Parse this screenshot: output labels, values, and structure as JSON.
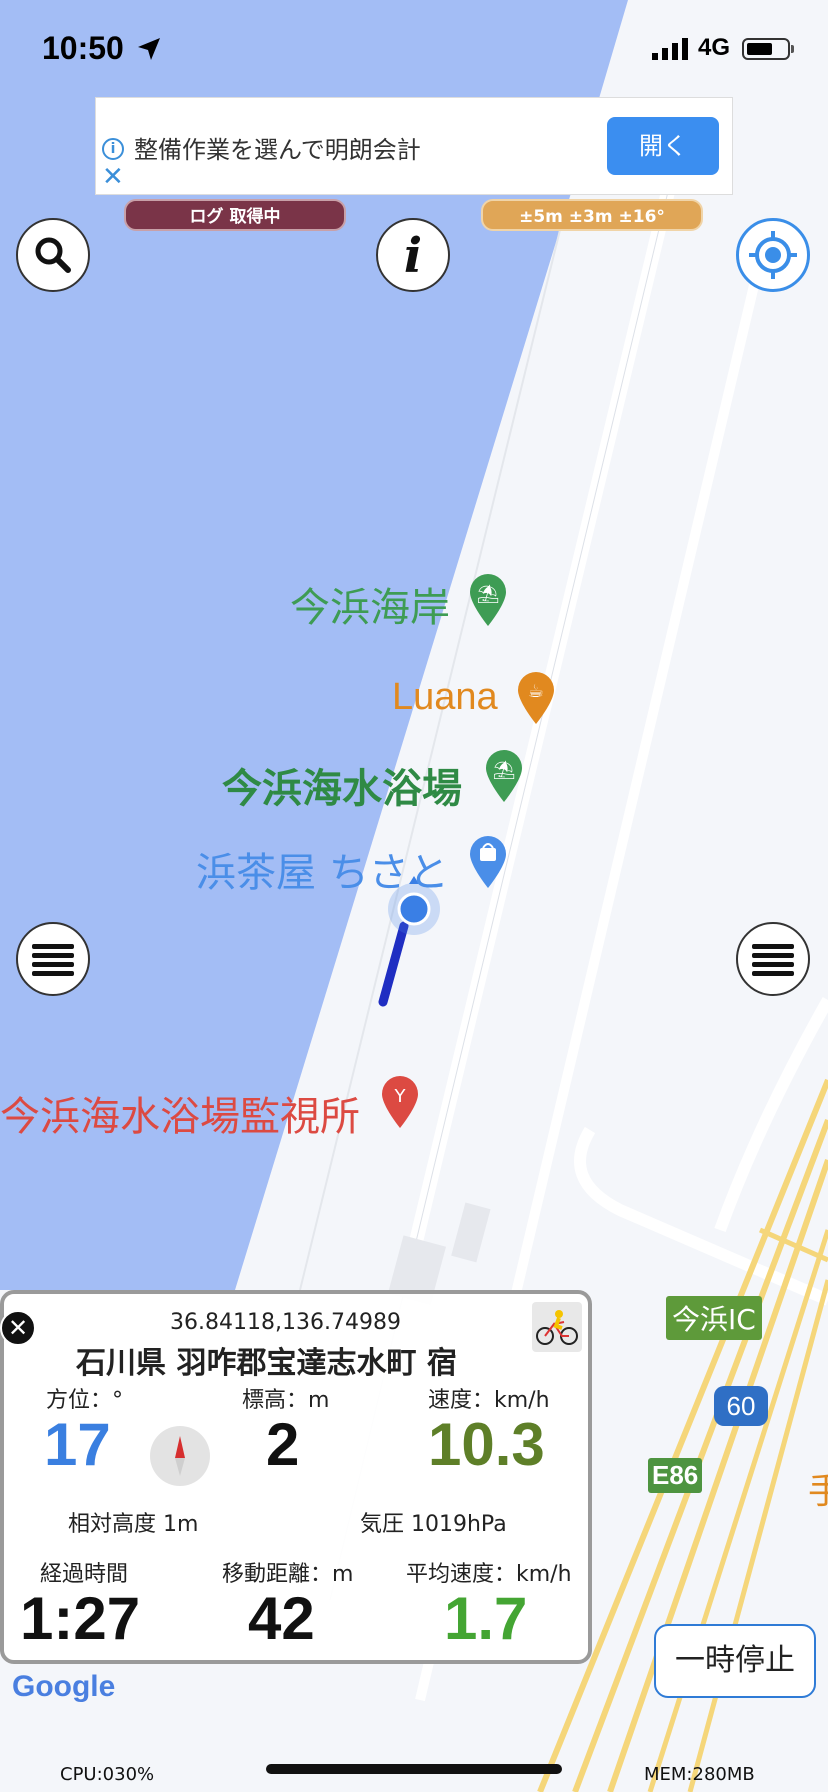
{
  "status_bar": {
    "time": "10:50",
    "network": "4G"
  },
  "ad": {
    "text": "整備作業を選んで明朗会計",
    "open_label": "開く",
    "info_icon": "i",
    "close_icon": "✕"
  },
  "overlays": {
    "log_status": "ログ 取得中",
    "accuracy": "±5m ±3m ±16°"
  },
  "map": {
    "labels": {
      "imahama_kaigan": "今浜海岸",
      "luana": "Luana",
      "kaisuiyokujo": "今浜海水浴場",
      "hamachaya": "浜茶屋 ちさと",
      "kanshijo": "今浜海水浴場監視所",
      "imahama_ic": "今浜IC",
      "route60": "60",
      "e86": "E86",
      "edge_char": "手"
    },
    "colors": {
      "water": "#a3bdf5",
      "land": "#f4f6fa",
      "poi_green": "#3e9c54",
      "poi_orange": "#e1891f",
      "poi_blue": "#4a8ee8",
      "poi_red": "#dc4a42"
    }
  },
  "panel": {
    "coords": "36.84118,136.74989",
    "address": "石川県 羽咋郡宝達志水町 宿",
    "heading_label": "方位：°",
    "heading_value": "17",
    "altitude_label": "標高：m",
    "altitude_value": "2",
    "speed_label": "速度：km/h",
    "speed_value": "10.3",
    "rel_alt": "相対高度 1m",
    "pressure": "気圧 1019hPa",
    "elapsed_label": "経過時間",
    "elapsed_value": "1:27",
    "distance_label": "移動距離：m",
    "distance_value": "42",
    "avg_speed_label": "平均速度：km/h",
    "avg_speed_value": "1.7",
    "colors": {
      "heading": "#3a7fe0",
      "speed": "#5e7f28",
      "avg": "#44a533"
    }
  },
  "pause_label": "一時停止",
  "google_logo": "Google",
  "footer": {
    "cpu": "CPU:030%",
    "mem": "MEM:280MB"
  }
}
